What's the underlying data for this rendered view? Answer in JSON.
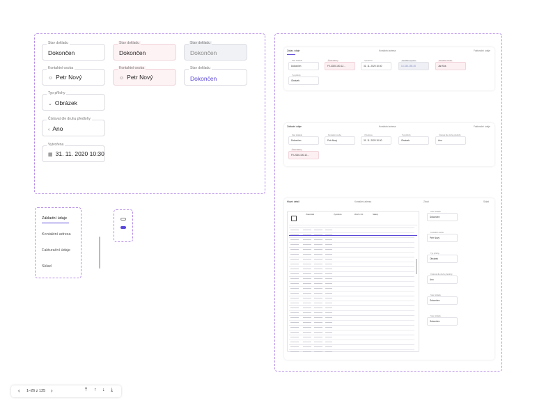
{
  "fields": {
    "stav1": {
      "label": "Stav dokladu",
      "value": "Dokončen"
    },
    "stav2": {
      "label": "Stav dokladu",
      "value": "Dokončen"
    },
    "stav3": {
      "label": "Stav dokladu",
      "value": "Dokončen"
    },
    "kontakt1": {
      "label": "Kontaktní osoba",
      "value": "Petr Nový"
    },
    "kontakt2": {
      "label": "Kontaktní osoba",
      "value": "Petr Nový"
    },
    "stav4": {
      "label": "Stav dokladu",
      "value": "Dokončen"
    },
    "typ": {
      "label": "Typ přílohy",
      "value": "Obrázek"
    },
    "cislovat": {
      "label": "Číslovat dle druhu předlohy",
      "value": "Ano"
    },
    "vytvoreno": {
      "label": "Vytvořena",
      "value": "31. 11. 2020 10:30"
    }
  },
  "nav": {
    "items": [
      "Základní údaje",
      "Kontaktní adresa",
      "Fakturační údaje",
      "Sklad"
    ]
  },
  "card1": {
    "tabs": [
      "Zákaz. údaje",
      "Kontaktní adresa",
      "Fakturační údaje"
    ],
    "fields": [
      {
        "label": "Stav dokladu",
        "value": "Dokončen"
      },
      {
        "label": "Číslo faktury",
        "value": "FV-2020-100-12..."
      },
      {
        "label": "Vytvořena",
        "value": "31. 11. 2020 10:30"
      },
      {
        "label": "Variabilní symbol",
        "value": "10-336-155-45"
      },
      {
        "label": "Kontaktní osoba",
        "value": "Jan Kos"
      },
      {
        "label": "Typ přílohy",
        "value": "Obrázek"
      }
    ]
  },
  "card2": {
    "tabs": [
      "Základní údaje",
      "Kontaktní adresa",
      "Fakturační údaje"
    ],
    "fields": [
      {
        "label": "Stav dokladu",
        "value": "Dokončen"
      },
      {
        "label": "Kontaktní osoba",
        "value": "Petr Nový"
      },
      {
        "label": "Vytvořena",
        "value": "31. 11. 2020 10:30"
      },
      {
        "label": "Typ přílohy",
        "value": "Obrázek"
      },
      {
        "label": "Číslovat dle druhu předlohy",
        "value": "Ano"
      },
      {
        "label": "Číslo faktury",
        "value": "FV-2020-100-12..."
      }
    ]
  },
  "card3": {
    "tabs": [
      "Hlavní detail",
      "Kontaktní adresa",
      "Zboží",
      "Sklad"
    ],
    "table_headers": [
      "Pracoviště",
      "Vytvořeno",
      "Zboží v Kč",
      "Sklady"
    ],
    "side_fields": [
      {
        "label": "Stav dokladu",
        "value": "Dokončen"
      },
      {
        "label": "Kontaktní osoba",
        "value": "Petr Nový"
      },
      {
        "label": "Typ přílohy",
        "value": "Obrázek"
      },
      {
        "label": "Číslovat dle druhu předlohy",
        "value": "Ano"
      },
      {
        "label": "Stav dokladu",
        "value": "Dokončen"
      },
      {
        "label": "Stav dokladu",
        "value": "Dokončen"
      }
    ]
  },
  "pagination": {
    "range": "1–26 z 125"
  },
  "colors": {
    "accent": "#5a48d8",
    "dashed": "#b58ae6",
    "pink_bg": "#fdf2f4",
    "gray_bg": "#f1f2f5"
  }
}
